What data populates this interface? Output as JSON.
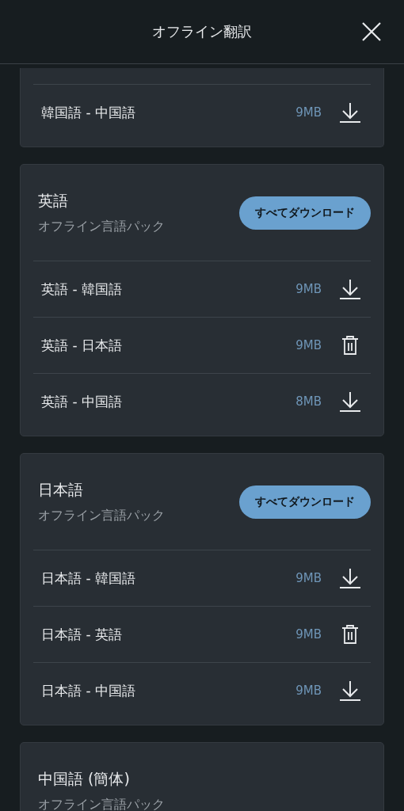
{
  "header": {
    "title": "オフライン翻訳"
  },
  "packs": [
    {
      "rows": [
        {
          "label": "韓国語 - 中国語",
          "size": "9MB",
          "downloaded": false
        }
      ]
    },
    {
      "title": "英語",
      "subtitle": "オフライン言語パック",
      "button": "すべてダウンロード",
      "rows": [
        {
          "label": "英語 - 韓国語",
          "size": "9MB",
          "downloaded": false
        },
        {
          "label": "英語 - 日本語",
          "size": "9MB",
          "downloaded": true
        },
        {
          "label": "英語 - 中国語",
          "size": "8MB",
          "downloaded": false
        }
      ]
    },
    {
      "title": "日本語",
      "subtitle": "オフライン言語パック",
      "button": "すべてダウンロード",
      "rows": [
        {
          "label": "日本語 - 韓国語",
          "size": "9MB",
          "downloaded": false
        },
        {
          "label": "日本語 - 英語",
          "size": "9MB",
          "downloaded": true
        },
        {
          "label": "日本語 - 中国語",
          "size": "9MB",
          "downloaded": false
        }
      ]
    },
    {
      "title": "中国語 (簡体)",
      "subtitle": "オフライン言語パック"
    }
  ]
}
